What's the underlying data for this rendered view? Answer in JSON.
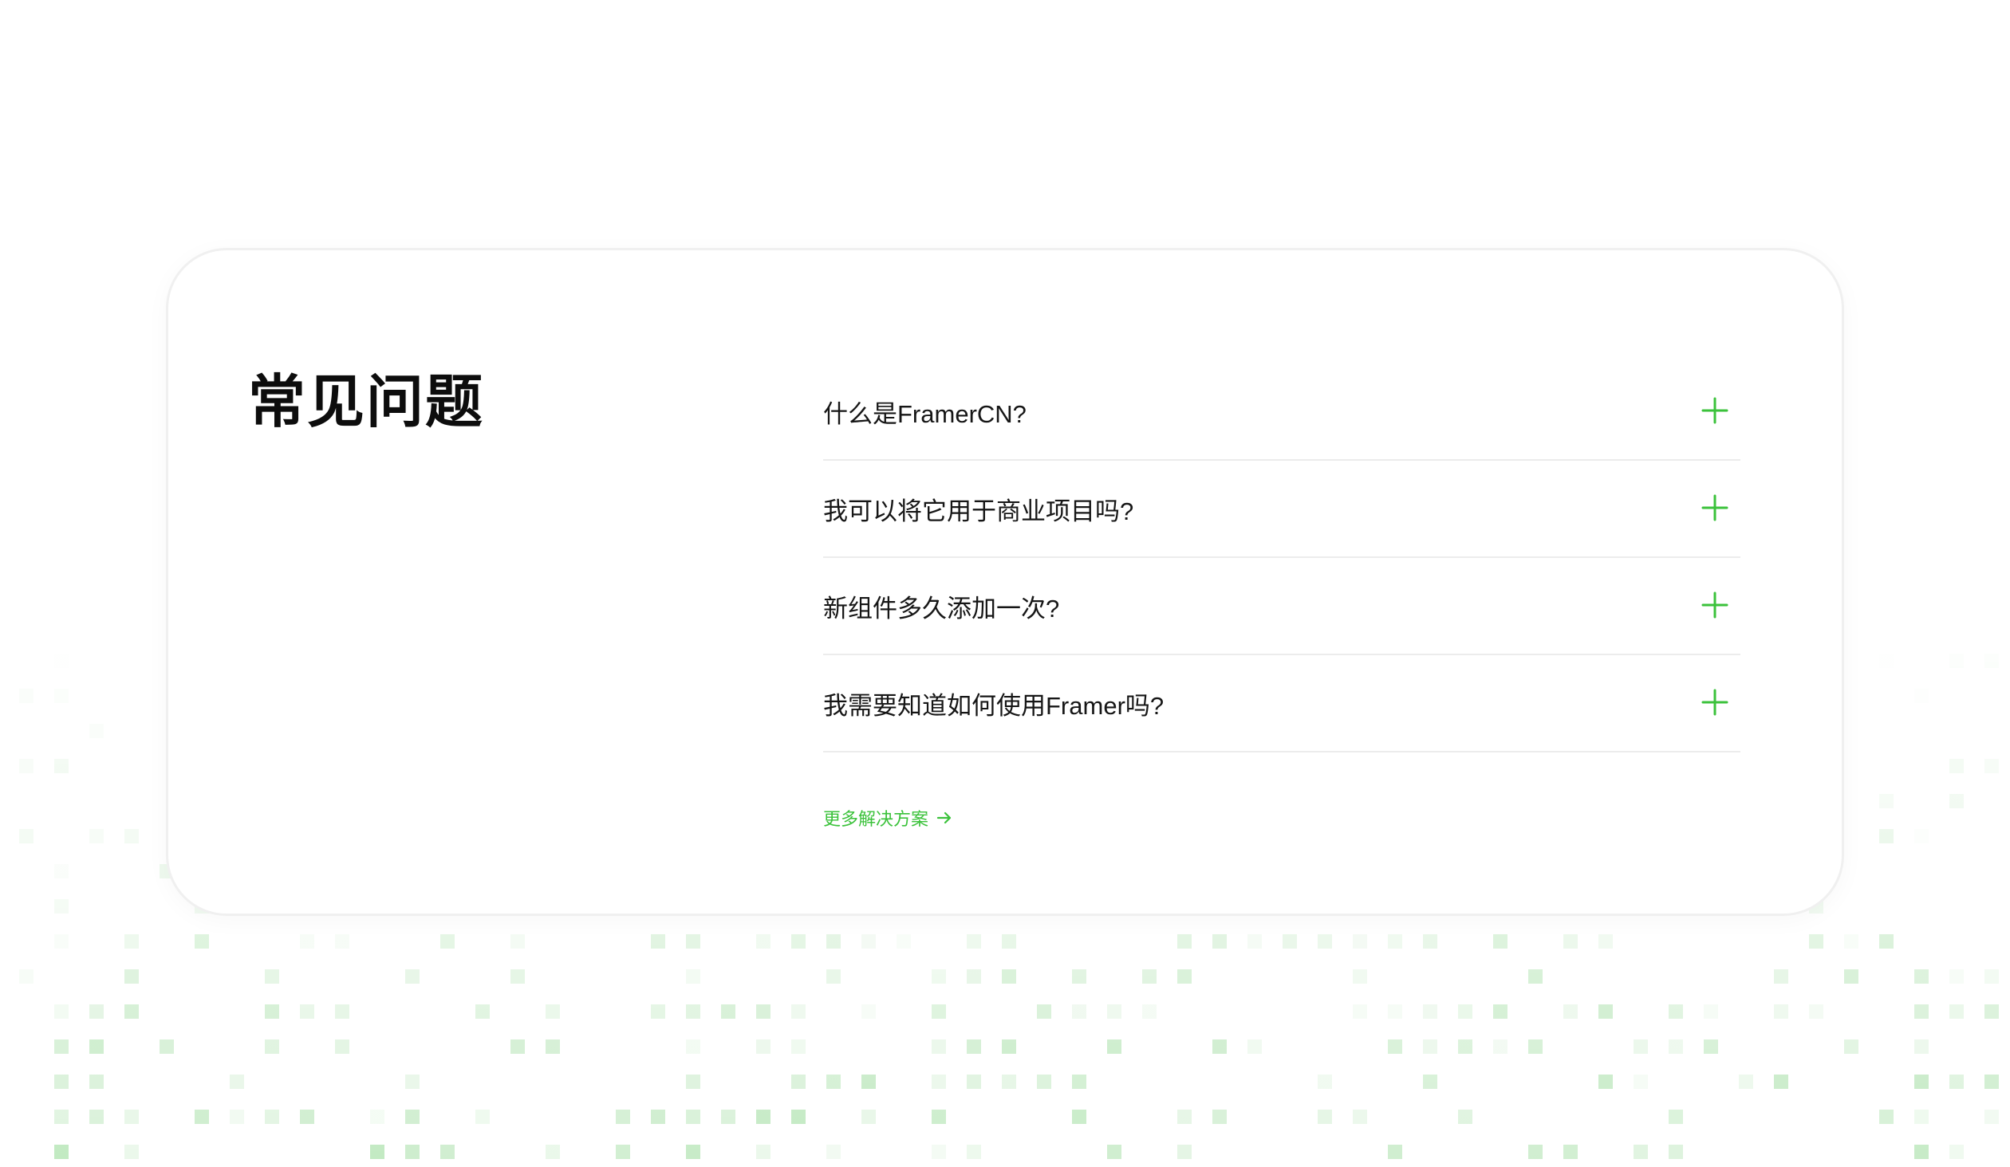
{
  "faq": {
    "title": "常见问题",
    "items": [
      {
        "question": "什么是FramerCN?",
        "icon": "plus-icon"
      },
      {
        "question": "我可以将它用于商业项目吗?",
        "icon": "plus-icon"
      },
      {
        "question": "新组件多久添加一次?",
        "icon": "plus-icon"
      },
      {
        "question": "我需要知道如何使用Framer吗?",
        "icon": "plus-icon"
      }
    ],
    "more_link": {
      "label": "更多解决方案",
      "icon": "arrow-right-icon"
    }
  },
  "colors": {
    "accent": "#3bc23b",
    "background_grid": "#4cbf4c",
    "text": "#161616",
    "divider": "#ececec"
  }
}
